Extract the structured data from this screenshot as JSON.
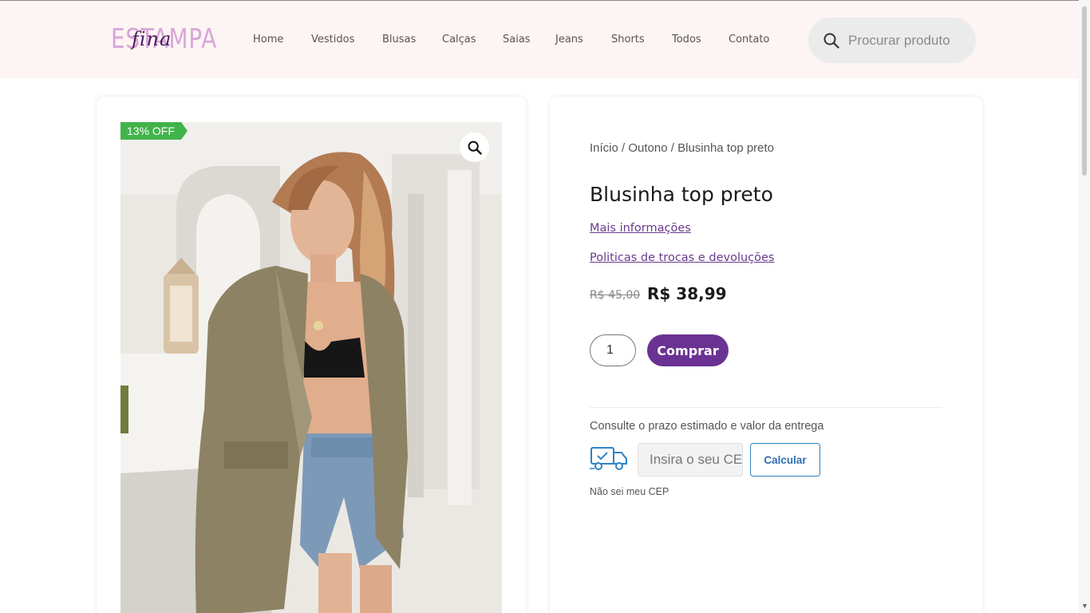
{
  "header": {
    "logo": {
      "main": "ESTAMPA",
      "script": "fina"
    },
    "nav": [
      "Home",
      "Vestidos",
      "Blusas",
      "Calças",
      "Saias",
      "Jeans",
      "Shorts",
      "Todos",
      "Contato"
    ],
    "search_placeholder": "Procurar produto"
  },
  "product": {
    "badge": "13% OFF",
    "breadcrumb": {
      "home": "Início",
      "category": "Outono",
      "current": "Blusinha top preto",
      "separator": " / "
    },
    "title": "Blusinha top preto",
    "links": {
      "more_info": "Mais informações",
      "policy": "Politicas de trocas e devoluções"
    },
    "price_old": "R$ 45,00",
    "price_new": "R$ 38,99",
    "quantity": "1",
    "buy_label": "Comprar"
  },
  "shipping": {
    "label": "Consulte o prazo estimado e valor da entrega",
    "cep_placeholder": "Insira o seu CEP",
    "calc_label": "Calcular",
    "no_cep": "Não sei meu CEP"
  },
  "colors": {
    "accent": "#6a3292",
    "badge": "#41b34a",
    "header_bg": "#fdf4f4",
    "calc_border": "#2d83c6"
  },
  "icons": {
    "search": "search-icon",
    "zoom": "zoom-icon",
    "truck": "delivery-truck-icon"
  }
}
